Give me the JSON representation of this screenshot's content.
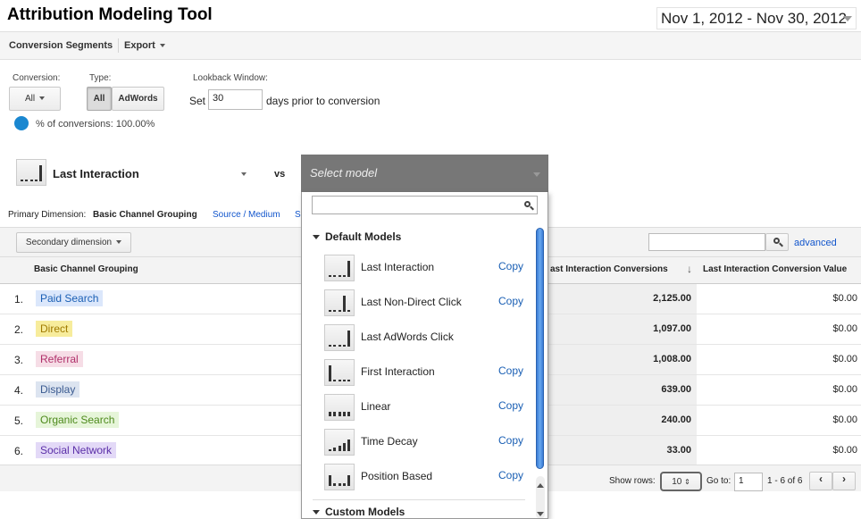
{
  "header": {
    "title": "Attribution Modeling Tool",
    "date_range": "Nov 1, 2012 - Nov 30, 2012"
  },
  "toolbar": {
    "conversion_segments": "Conversion Segments",
    "export": "Export"
  },
  "filters": {
    "conversion_label": "Conversion:",
    "conversion_value": "All",
    "type_label": "Type:",
    "type_all": "All",
    "type_adwords": "AdWords",
    "lookback_label": "Lookback Window:",
    "lookback_set": "Set",
    "lookback_days": "30",
    "lookback_suffix": "days prior to conversion",
    "pct_conversions": "% of conversions: 100.00%",
    "pct_conversions_value": 100
  },
  "model_compare": {
    "primary_model": "Last Interaction",
    "vs": "vs",
    "select_placeholder": "Select model"
  },
  "dimension": {
    "label": "Primary Dimension:",
    "active": "Basic Channel Grouping",
    "other": "Source / Medium",
    "other_cut": "S",
    "secondary": "Secondary dimension",
    "advanced": "advanced"
  },
  "table": {
    "columns": {
      "channel": "Basic Channel Grouping",
      "conversions": "ast Interaction Conversions",
      "value": "Last Interaction Conversion Value"
    },
    "rows": [
      {
        "num": "1.",
        "channel": "Paid Search",
        "color": "#dbe7fb",
        "text_color": "#1a5fb4",
        "conversions": "2,125.00",
        "value": "$0.00"
      },
      {
        "num": "2.",
        "channel": "Direct",
        "color": "#f7ec9c",
        "text_color": "#a07a00",
        "conversions": "1,097.00",
        "value": "$0.00"
      },
      {
        "num": "3.",
        "channel": "Referral",
        "color": "#f6dde6",
        "text_color": "#b0306a",
        "conversions": "1,008.00",
        "value": "$0.00"
      },
      {
        "num": "4.",
        "channel": "Display",
        "color": "#dce4f0",
        "text_color": "#3a5a90",
        "conversions": "639.00",
        "value": "$0.00"
      },
      {
        "num": "5.",
        "channel": "Organic Search",
        "color": "#e6f5d9",
        "text_color": "#4d8a1c",
        "conversions": "240.00",
        "value": "$0.00"
      },
      {
        "num": "6.",
        "channel": "Social Network",
        "color": "#e3d9f7",
        "text_color": "#5b2fa8",
        "conversions": "33.00",
        "value": "$0.00"
      }
    ]
  },
  "footer": {
    "show_rows_label": "Show rows:",
    "show_rows_value": "10",
    "goto_label": "Go to:",
    "goto_value": "1",
    "range": "1 - 6 of 6"
  },
  "dropdown": {
    "default_group": "Default Models",
    "custom_group": "Custom Models",
    "items": [
      {
        "label": "Last Interaction",
        "copy": "Copy",
        "icon": "last-interaction-icon"
      },
      {
        "label": "Last Non-Direct Click",
        "copy": "Copy",
        "icon": "last-non-direct-click-icon"
      },
      {
        "label": "Last AdWords Click",
        "copy": "",
        "icon": "last-adwords-click-icon"
      },
      {
        "label": "First Interaction",
        "copy": "Copy",
        "icon": "first-interaction-icon"
      },
      {
        "label": "Linear",
        "copy": "Copy",
        "icon": "linear-icon"
      },
      {
        "label": "Time Decay",
        "copy": "Copy",
        "icon": "time-decay-icon"
      },
      {
        "label": "Position Based",
        "copy": "Copy",
        "icon": "position-based-icon"
      }
    ]
  }
}
